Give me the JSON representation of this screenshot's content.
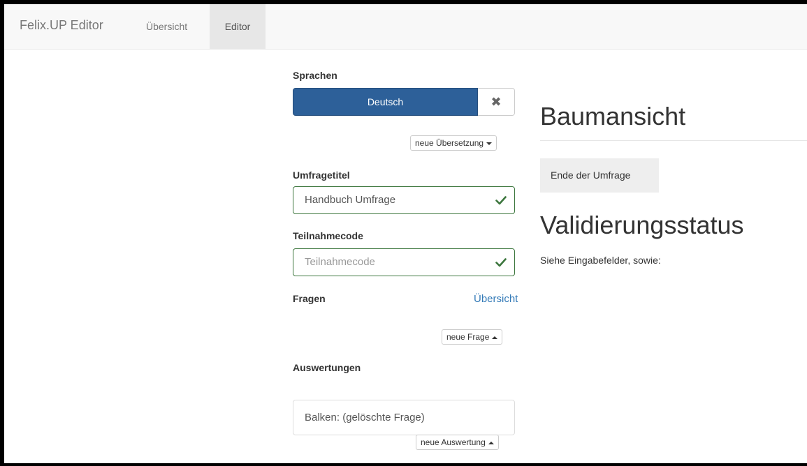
{
  "navbar": {
    "brand": "Felix.UP Editor",
    "links": [
      {
        "label": "Übersicht",
        "active": false
      },
      {
        "label": "Editor",
        "active": true
      }
    ]
  },
  "languages": {
    "label": "Sprachen",
    "selected": "Deutsch",
    "remove_icon": "close-icon",
    "new_translation": "neue Übersetzung"
  },
  "survey_title": {
    "label": "Umfragetitel",
    "value": "Handbuch Umfrage",
    "valid_icon": "check-icon"
  },
  "participation_code": {
    "label": "Teilnahmecode",
    "placeholder": "Teilnahmecode",
    "valid_icon": "check-icon"
  },
  "questions": {
    "label": "Fragen",
    "overview_link": "Übersicht",
    "new_question": "neue Frage"
  },
  "evaluations": {
    "label": "Auswertungen",
    "items": [
      "Balken: (gelöschte Frage)"
    ],
    "new_evaluation": "neue Auswertung"
  },
  "tree_view": {
    "title": "Baumansicht",
    "end_node": "Ende der Umfrage"
  },
  "validation": {
    "title": "Validierungsstatus",
    "text": "Siehe Eingabefelder, sowie:"
  },
  "colors": {
    "primary": "#2d6099",
    "success": "#3c763d",
    "link": "#337ab7"
  }
}
